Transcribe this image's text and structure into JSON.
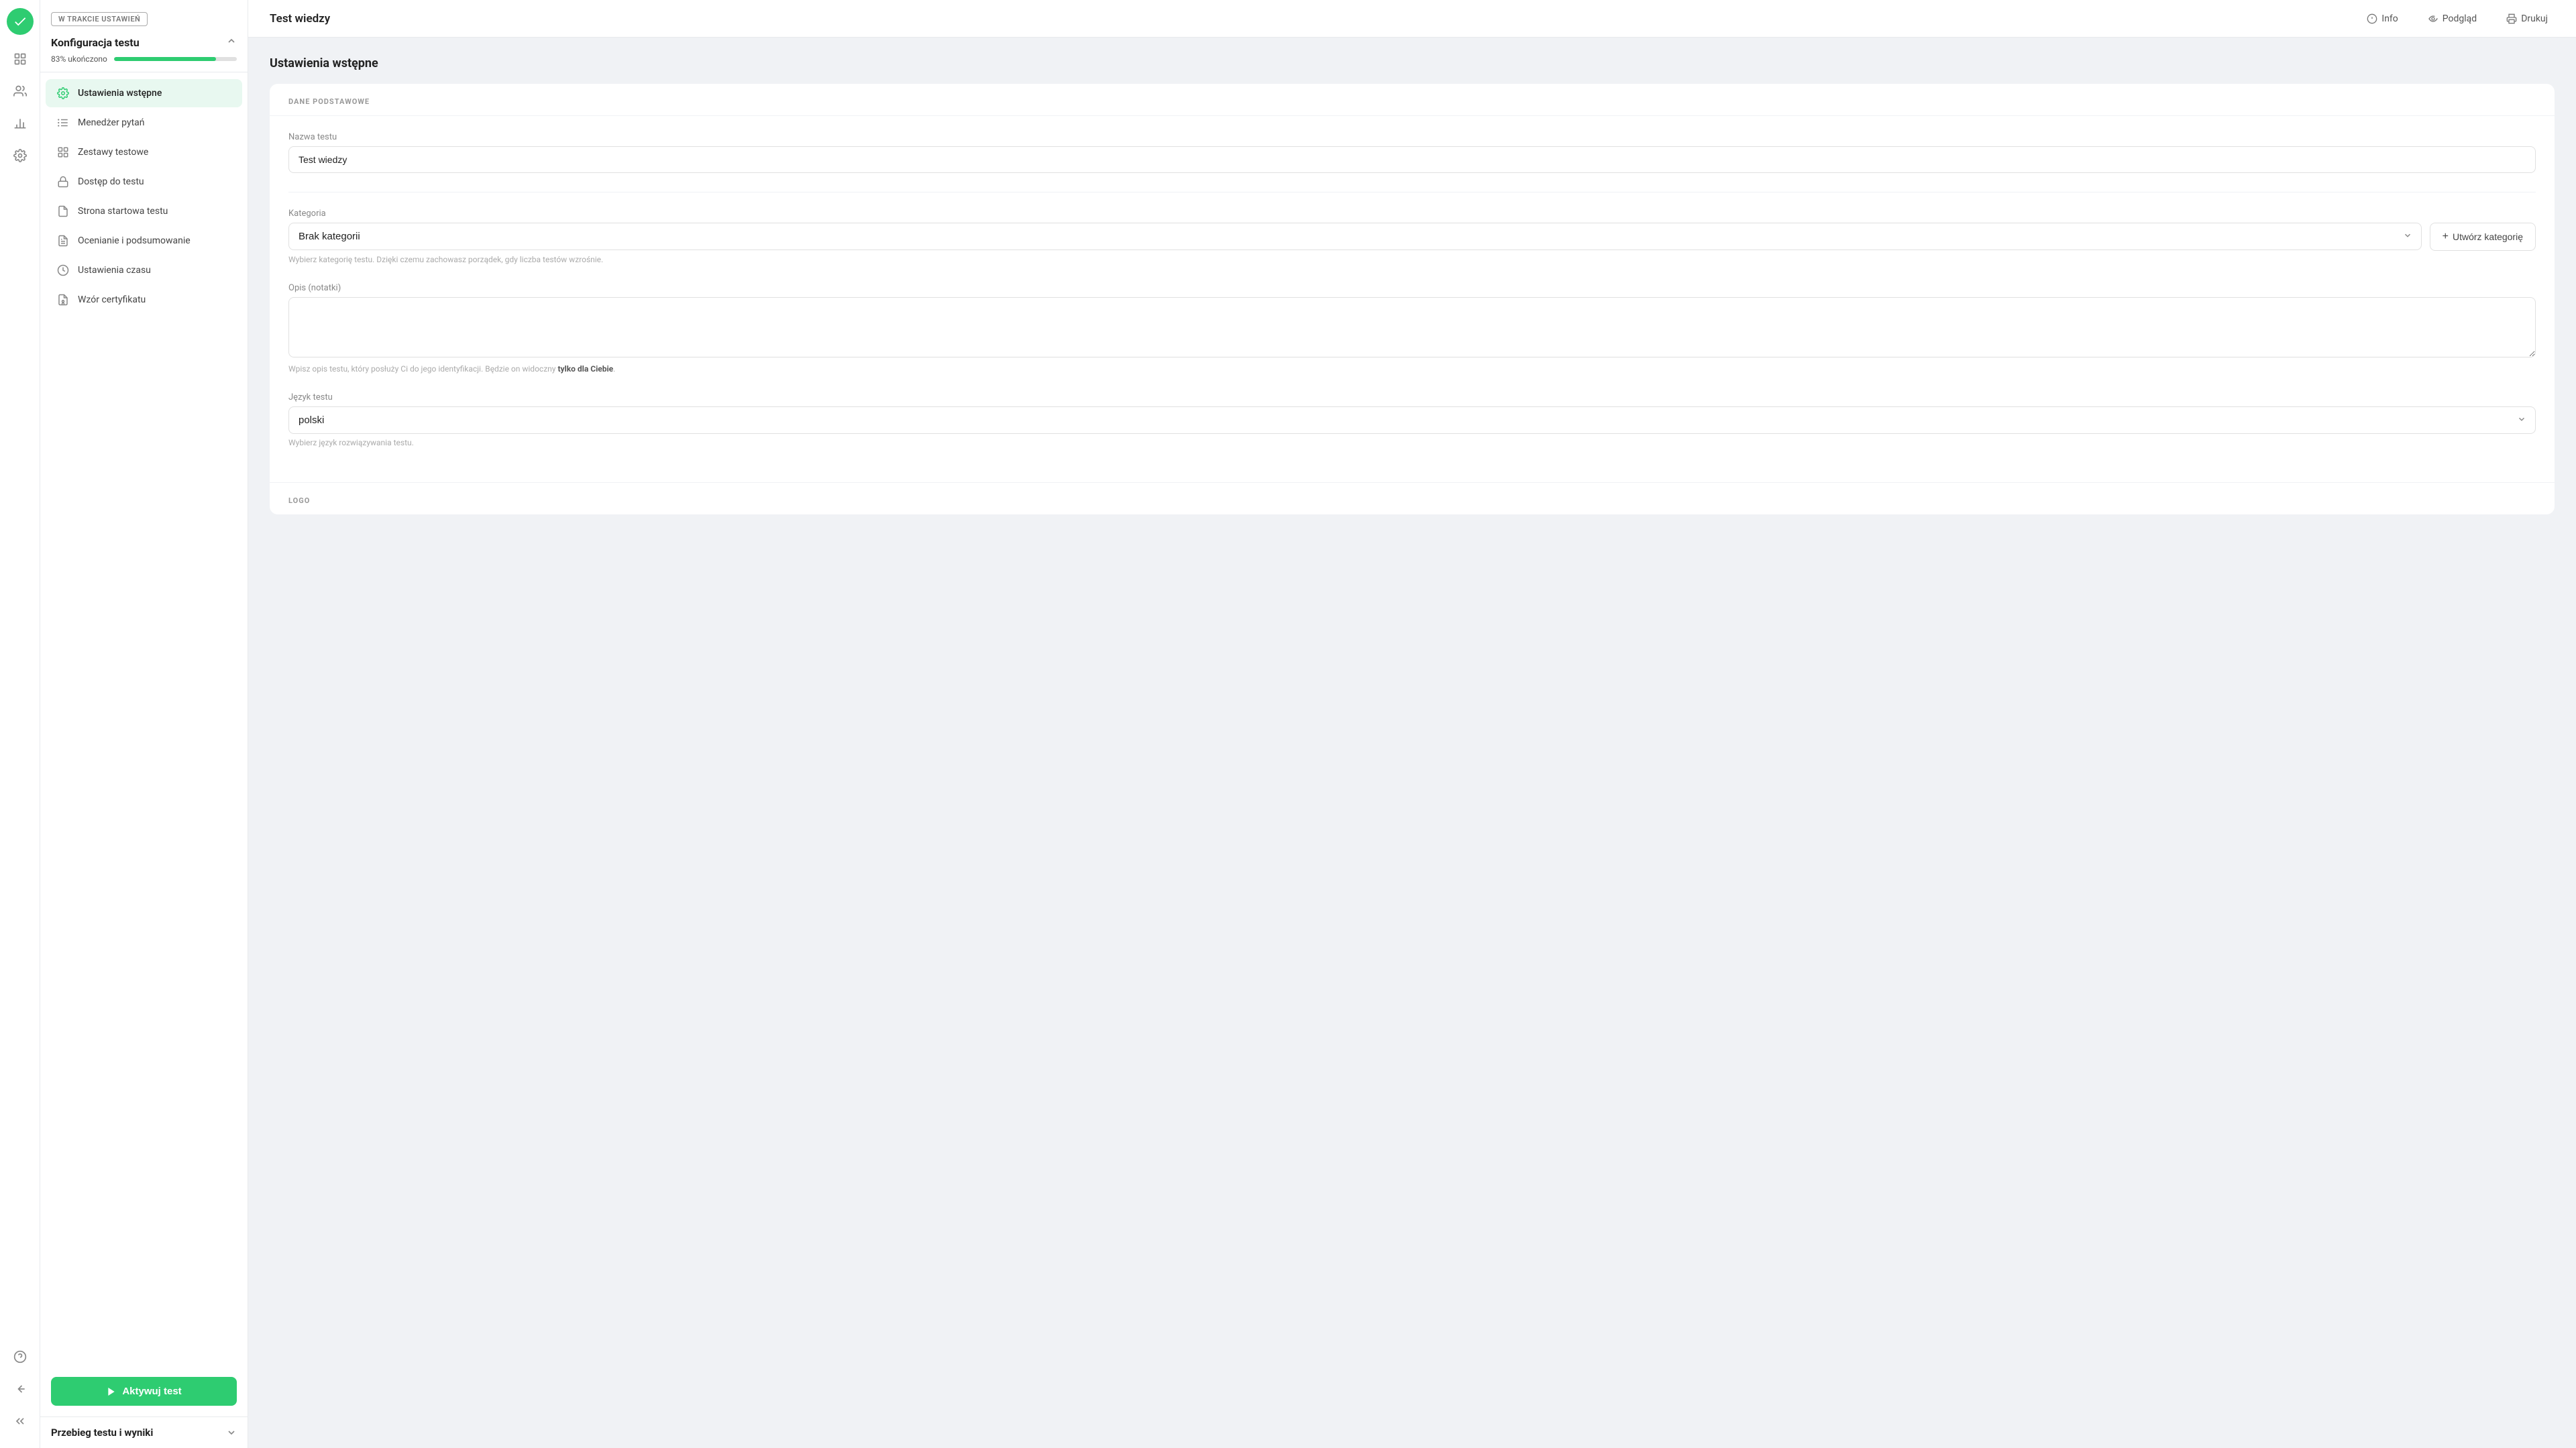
{
  "app": {
    "title": "Test wiedzy"
  },
  "topbar": {
    "title": "Test wiedzy",
    "info_label": "Info",
    "preview_label": "Podgląd",
    "print_label": "Drukuj"
  },
  "sidebar": {
    "status_badge": "W TRAKCIE USTAWIEŃ",
    "config_title": "Konfiguracja testu",
    "progress_label": "83% ukończono",
    "progress_value": 83,
    "nav_items": [
      {
        "id": "ustawienia-wstepne",
        "label": "Ustawienia wstępne",
        "active": true
      },
      {
        "id": "menedzer-pytan",
        "label": "Menedżer pytań",
        "active": false
      },
      {
        "id": "zestawy-testowe",
        "label": "Zestawy testowe",
        "active": false
      },
      {
        "id": "dostep-do-testu",
        "label": "Dostęp do testu",
        "active": false
      },
      {
        "id": "strona-startowa",
        "label": "Strona startowa testu",
        "active": false
      },
      {
        "id": "ocenianie",
        "label": "Ocenianie i podsumowanie",
        "active": false
      },
      {
        "id": "ustawienia-czasu",
        "label": "Ustawienia czasu",
        "active": false
      },
      {
        "id": "wzor-certyfikatu",
        "label": "Wzór certyfikatu",
        "active": false
      }
    ],
    "activate_btn_label": "Aktywuj test",
    "section2_title": "Przebieg testu i wyniki"
  },
  "main": {
    "page_title": "Ustawienia wstępne",
    "section1_heading": "DANE PODSTAWOWE",
    "field_name_label": "Nazwa testu",
    "field_name_value": "Test wiedzy",
    "field_category_label": "Kategoria",
    "field_category_value": "Brak kategorii",
    "field_category_hint": "Wybierz kategorię testu. Dzięki czemu zachowasz porządek, gdy liczba testów wzrośnie.",
    "create_category_label": "+ Utwórz kategorię",
    "field_notes_label": "Opis (notatki)",
    "field_notes_hint_start": "Wpisz opis testu, który posłuży Ci do jego identyfikacji. Będzie on widoczny ",
    "field_notes_hint_bold": "tylko dla Ciebie",
    "field_notes_hint_end": ".",
    "field_language_label": "Język testu",
    "field_language_value": "polski",
    "field_language_hint": "Wybierz język rozwiązywania testu.",
    "section2_heading": "LOGO"
  },
  "icons": {
    "logo_check": "✓",
    "grid": "⊞",
    "users": "👥",
    "chart": "📊",
    "settings": "⚙",
    "question": "?",
    "back": "←",
    "chevron_right": "»",
    "info": "ℹ",
    "eye": "👁",
    "printer": "🖨"
  }
}
